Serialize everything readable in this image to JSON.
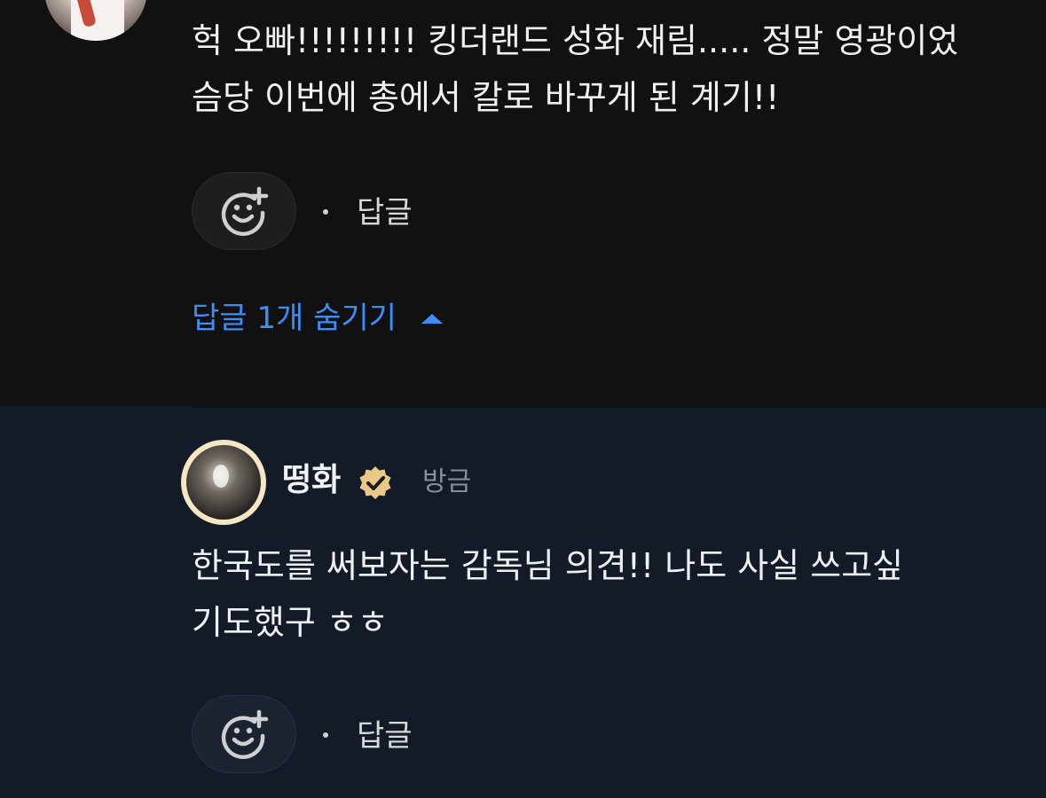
{
  "top_comment": {
    "text_lines": [
      "헉 오빠!!!!!!!!! 킹더랜드 성화 재림..... 정말 영광이었",
      "슴당 이번에 총에서 칼로 바꾸게 된 계기!!"
    ],
    "reply_label": "답글",
    "hide_replies_label": "답글 1개 숨기기"
  },
  "reply_comment": {
    "username": "떵화",
    "timestamp": "방금",
    "text_lines": [
      "한국도를 써보자는 감독님 의견!! 나도 사실 쓰고싶",
      "기도했구 ㅎㅎ"
    ],
    "reply_label": "답글"
  },
  "icons": {
    "emoji_reaction": "add-reaction-icon",
    "verified": "verified-badge-icon",
    "collapse": "caret-up-icon"
  },
  "colors": {
    "background_top": "#111111",
    "background_reply": "#141b28",
    "accent_blue": "#3e8ef7",
    "verified_gold": "#e8c98a"
  }
}
